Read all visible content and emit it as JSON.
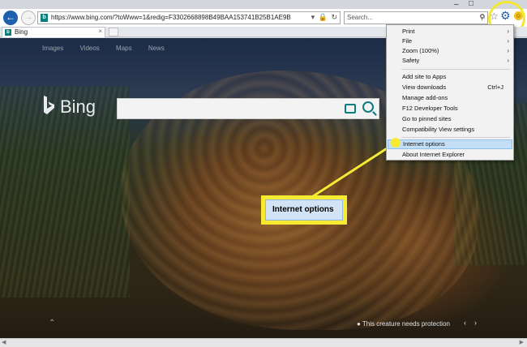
{
  "browser": {
    "url": "https://www.bing.com/?toWww=1&redig=F3302668898B49BAA153741B25B1AE9B",
    "search_placeholder": "Search...",
    "tab_label": "Bing"
  },
  "bing": {
    "nav": [
      "Images",
      "Videos",
      "Maps",
      "News"
    ],
    "logo_text": "Bing",
    "credit": "This creature needs protection"
  },
  "tools_menu": {
    "items": [
      {
        "label": "Print",
        "submenu": true
      },
      {
        "label": "File",
        "submenu": true
      },
      {
        "label": "Zoom (100%)",
        "submenu": true
      },
      {
        "label": "Safety",
        "submenu": true
      },
      {
        "label": "Add site to Apps"
      },
      {
        "label": "View downloads",
        "shortcut": "Ctrl+J"
      },
      {
        "label": "Manage add-ons"
      },
      {
        "label": "F12 Developer Tools"
      },
      {
        "label": "Go to pinned sites"
      },
      {
        "label": "Compatibility View settings"
      },
      {
        "label": "Internet options",
        "selected": true
      },
      {
        "label": "About Internet Explorer"
      }
    ]
  },
  "callout": {
    "label": "Internet options"
  },
  "colors": {
    "highlight": "#f6ea33",
    "selection": "#c4dff5",
    "accent": "#1d5a9f"
  }
}
